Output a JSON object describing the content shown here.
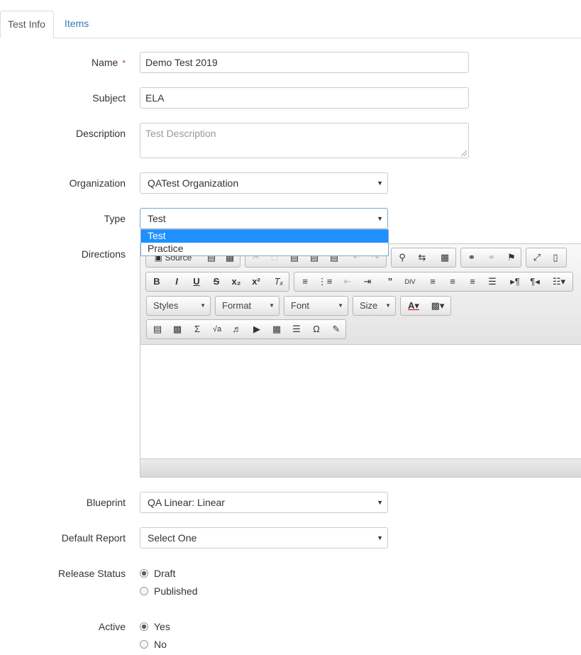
{
  "tabs": [
    {
      "label": "Test Info",
      "active": true
    },
    {
      "label": "Items",
      "active": false
    }
  ],
  "form": {
    "name": {
      "label": "Name",
      "required_mark": "*",
      "value": "Demo Test 2019"
    },
    "subject": {
      "label": "Subject",
      "value": "ELA"
    },
    "description": {
      "label": "Description",
      "value": "",
      "placeholder": "Test Description"
    },
    "organization": {
      "label": "Organization",
      "value": "QATest Organization"
    },
    "type": {
      "label": "Type",
      "value": "Test",
      "options": [
        "Test",
        "Practice"
      ],
      "highlighted": "Test"
    },
    "directions": {
      "label": "Directions"
    },
    "blueprint": {
      "label": "Blueprint",
      "value": "QA Linear: Linear"
    },
    "default_report": {
      "label": "Default Report",
      "value": "Select One"
    },
    "release_status": {
      "label": "Release Status",
      "options": [
        "Draft",
        "Published"
      ],
      "selected": "Draft"
    },
    "active": {
      "label": "Active",
      "options": [
        "Yes",
        "No"
      ],
      "selected": "Yes"
    }
  },
  "editor": {
    "source_label": "Source",
    "combos": {
      "styles": "Styles",
      "format": "Format",
      "font": "Font",
      "size": "Size"
    }
  }
}
